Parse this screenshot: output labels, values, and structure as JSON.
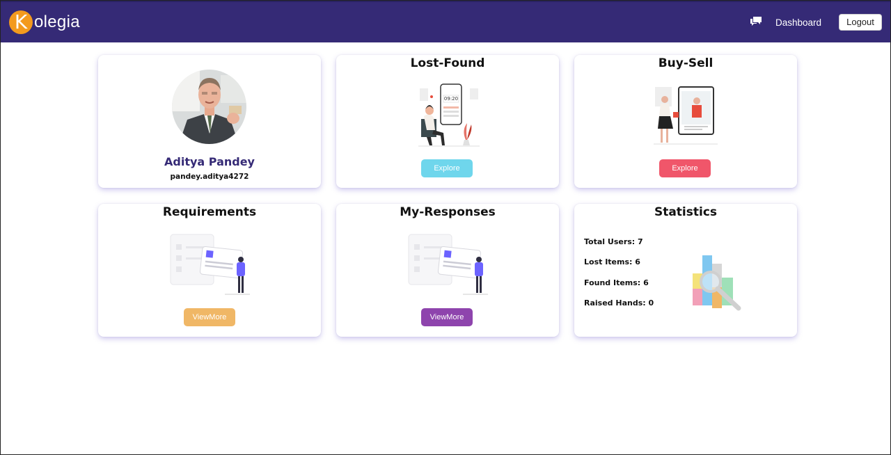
{
  "brand": {
    "letter": "K",
    "rest": "olegia"
  },
  "nav": {
    "dashboard": "Dashboard",
    "logout": "Logout"
  },
  "profile": {
    "name": "Aditya Pandey",
    "username": "pandey.aditya4272"
  },
  "cards": {
    "lost_found": {
      "title": "Lost-Found",
      "button": "Explore",
      "color": "#6fd6ec",
      "clock": "09:20"
    },
    "buy_sell": {
      "title": "Buy-Sell",
      "button": "Explore",
      "color": "#f0566a"
    },
    "requirements": {
      "title": "Requirements",
      "button": "ViewMore",
      "color": "#f0b766"
    },
    "my_responses": {
      "title": "My-Responses",
      "button": "ViewMore",
      "color": "#8e44ad"
    },
    "statistics": {
      "title": "Statistics",
      "items": [
        {
          "label": "Total Users:",
          "value": "7"
        },
        {
          "label": "Lost Items:",
          "value": "6"
        },
        {
          "label": "Found Items:",
          "value": "6"
        },
        {
          "label": "Raised Hands:",
          "value": "0"
        }
      ]
    }
  },
  "colors": {
    "navbar": "#352a76",
    "brand_orange": "#f39a1e"
  }
}
